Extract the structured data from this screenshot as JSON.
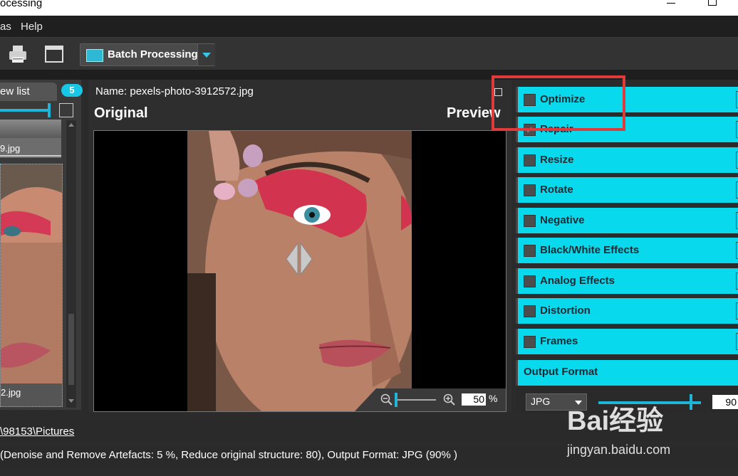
{
  "window": {
    "title": "ocessing"
  },
  "menu": {
    "items": [
      "as",
      "Help"
    ]
  },
  "toolbar": {
    "batch_label": "Batch Processing",
    "icons": [
      "printer-icon",
      "window-icon",
      "batch-processing-icon",
      "chevron-down-icon"
    ]
  },
  "left_panel": {
    "tab_label": "ew list",
    "count": "5",
    "thumbnails": [
      {
        "name": "9.jpg"
      },
      {
        "name": "2.jpg"
      }
    ]
  },
  "center": {
    "name_label": "Name: pexels-photo-3912572.jpg",
    "original_label": "Original",
    "preview_label": "Preview",
    "zoom_value": "50",
    "zoom_unit": "%"
  },
  "right_panel": {
    "effects": [
      {
        "label": "Optimize",
        "checked": false
      },
      {
        "label": "Repair",
        "checked": true
      },
      {
        "label": "Resize",
        "checked": false
      },
      {
        "label": "Rotate",
        "checked": false
      },
      {
        "label": "Negative",
        "checked": false
      },
      {
        "label": "Black/White Effects",
        "checked": false
      },
      {
        "label": "Analog Effects",
        "checked": false
      },
      {
        "label": "Distortion",
        "checked": false
      },
      {
        "label": "Frames",
        "checked": false
      }
    ],
    "output_format": {
      "title": "Output Format",
      "format": "JPG",
      "quality": "90"
    }
  },
  "status": {
    "path": "\\98153\\Pictures",
    "summary": "(Denoise and Remove Artefacts: 5 %, Reduce original structure: 80), Output Format: JPG (90% )"
  },
  "watermark": {
    "big": "Bai经验",
    "small": "jingyan.baidu.com"
  },
  "colors": {
    "accent": "#08d9ec",
    "highlight": "#e03a3a",
    "background": "#2b2b2b"
  }
}
